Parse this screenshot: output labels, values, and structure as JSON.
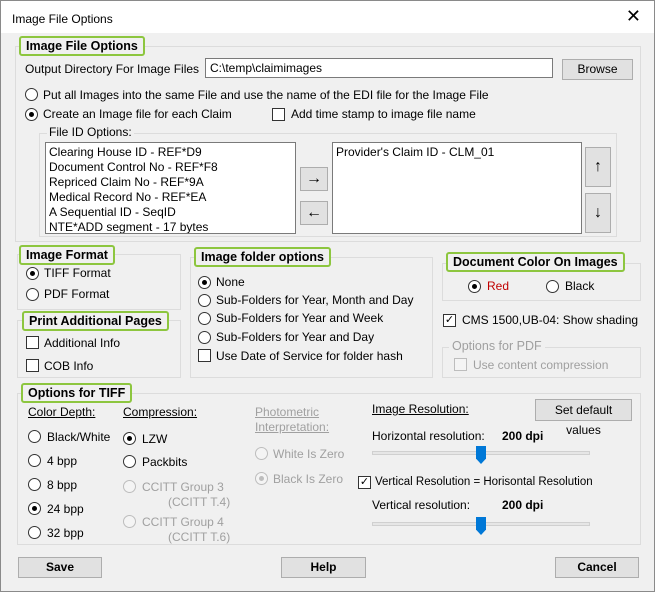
{
  "window": {
    "title": "Image File Options",
    "close_glyph": "✕"
  },
  "image_file_options": {
    "group_title": "Image File Options",
    "output_dir_label": "Output Directory For Image Files",
    "output_dir_value": "C:\\temp\\claimimages",
    "browse_label": "Browse",
    "radio_all_in_one": "Put all Images into the same File and use the name of the EDI file for the Image File",
    "radio_each_claim": "Create an Image file for each Claim",
    "timestamp_label": "Add time stamp to image file name",
    "file_id_label": "File ID Options:",
    "available_ids": [
      "Clearing House ID - REF*D9",
      "Document Control No - REF*F8",
      "Repriced Claim No - REF*9A",
      "Medical Record No - REF*EA",
      "A Sequential ID - SeqID",
      "NTE*ADD segment - 17 bytes"
    ],
    "selected_ids": [
      "Provider's Claim ID - CLM_01"
    ],
    "move_right_glyph": "→",
    "move_left_glyph": "←",
    "move_up_glyph": "↑",
    "move_down_glyph": "↓"
  },
  "image_format": {
    "group_title": "Image Format",
    "tiff_label": "TIFF Format",
    "pdf_label": "PDF Format",
    "selected": "TIFF Format"
  },
  "image_folder_options": {
    "group_title": "Image folder options",
    "none_label": "None",
    "ymd_label": "Sub-Folders for Year, Month and Day",
    "yw_label": "Sub-Folders for Year and Week",
    "yd_label": "Sub-Folders for Year and Day",
    "dos_label": "Use Date of Service for folder hash",
    "selected": "None"
  },
  "document_color": {
    "group_title": "Document Color On Images",
    "red_label": "Red",
    "black_label": "Black",
    "selected": "Red",
    "red_color": "#c00000"
  },
  "cms_shading_label": "CMS 1500,UB-04: Show shading",
  "pdf_options": {
    "group_title": "Options for PDF",
    "content_compression_label": "Use content compression"
  },
  "print_additional": {
    "group_title": "Print Additional Pages",
    "additional_info_label": "Additional  Info",
    "cob_info_label": "COB Info"
  },
  "tiff_options": {
    "group_title": "Options for TIFF",
    "color_depth_label": "Color Depth:",
    "depths": [
      "Black/White",
      "4 bpp",
      "8 bpp",
      "24 bpp",
      "32 bpp"
    ],
    "selected_depth": "24 bpp",
    "compression_label": "Compression:",
    "lzw_label": "LZW",
    "packbits_label": "Packbits",
    "ccitt3_label_1": "CCITT Group 3",
    "ccitt3_label_2": "(CCITT T.4)",
    "ccitt4_label_1": "CCITT Group 4",
    "ccitt4_label_2": "(CCITT T.6)",
    "photometric_label_1": "Photometric",
    "photometric_label_2": "Interpretation:",
    "white_zero_label": "White Is Zero",
    "black_zero_label": "Black Is Zero",
    "image_resolution_label": "Image Resolution:",
    "set_default_label": "Set default values",
    "horizontal_label": "Horizontal resolution:",
    "horizontal_value": "200 dpi",
    "horizontal_level": 0.5,
    "vertical_equals_label": "Vertical Resolution = Horisontal Resolution",
    "vertical_label": "Vertical resolution:",
    "vertical_value": "200 dpi",
    "vertical_level": 0.5,
    "accent_color": "#0078d7",
    "highlight_color": "#8dc63f"
  },
  "footer": {
    "save_label": "Save",
    "help_label": "Help",
    "cancel_label": "Cancel"
  }
}
